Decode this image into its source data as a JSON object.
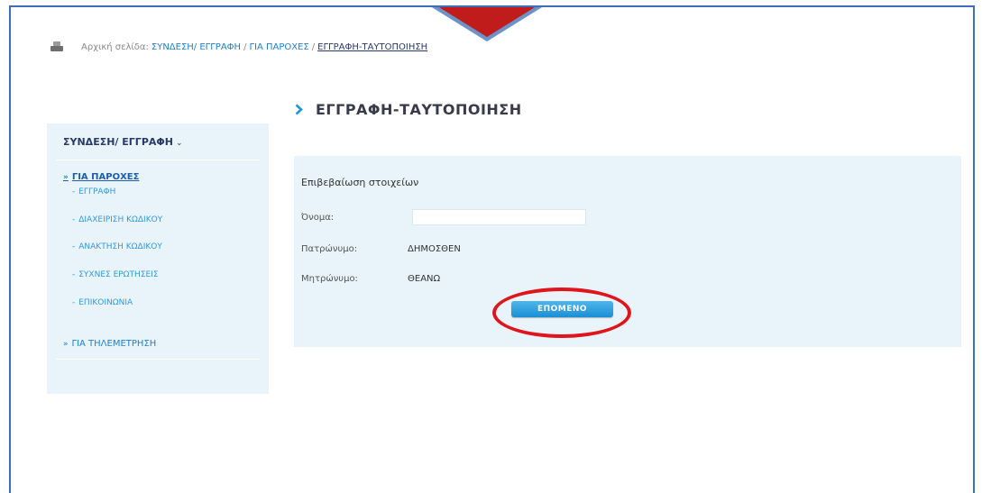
{
  "breadcrumb": {
    "prefix": "Αρχική σελίδα:",
    "items": [
      {
        "label": "ΣΥΝΔΕΣΗ/ ΕΓΓΡΑΦΗ"
      },
      {
        "label": "ΓΙΑ ΠΑΡΟΧΕΣ"
      }
    ],
    "separator": "/",
    "current": "ΕΓΓΡΑΦΗ-ΤΑΥΤΟΠΟΙΗΣΗ",
    "icon": "printer-icon"
  },
  "sidebar": {
    "title": "ΣΥΝΔΕΣΗ/ ΕΓΓΡΑΦΗ",
    "title_chevron": "⌄",
    "groups": [
      {
        "marker": "»",
        "label": "ΓΙΑ ΠΑΡΟΧΕΣ",
        "active": true,
        "items": [
          {
            "label": "ΕΓΓΡΑΦΗ"
          },
          {
            "label": "ΔΙΑΧΕΙΡΙΣΗ ΚΩΔΙΚΟΥ"
          },
          {
            "label": "ΑΝΑΚΤΗΣΗ ΚΩΔΙΚΟΥ"
          },
          {
            "label": "ΣΥΧΝΕΣ ΕΡΩΤΗΣΕΙΣ"
          },
          {
            "label": "ΕΠΙΚΟΙΝΩΝΙΑ"
          }
        ]
      },
      {
        "marker": "»",
        "label": "ΓΙΑ ΤΗΛΕΜΕΤΡΗΣΗ",
        "active": false
      }
    ],
    "item_dash": "-"
  },
  "page": {
    "title": "ΕΓΓΡΑΦΗ-ΤΑΥΤΟΠΟΙΗΣΗ"
  },
  "panel": {
    "title": "Επιβεβαίωση στοιχείων",
    "fields": [
      {
        "label": "Όνομα:",
        "value": ""
      },
      {
        "label": "Πατρώνυμο:",
        "value": "ΔΗΜΟΣΘΕΝ"
      },
      {
        "label": "Μητρώνυμο:",
        "value": "ΘΕΑΝΩ"
      }
    ],
    "next_button": "ΕΠΟΜΕΝΟ"
  },
  "colors": {
    "accent": "#1f7fc9",
    "panel_bg": "#e8f4fa",
    "highlight": "#e0141c",
    "arrow": "#c11c1c"
  }
}
